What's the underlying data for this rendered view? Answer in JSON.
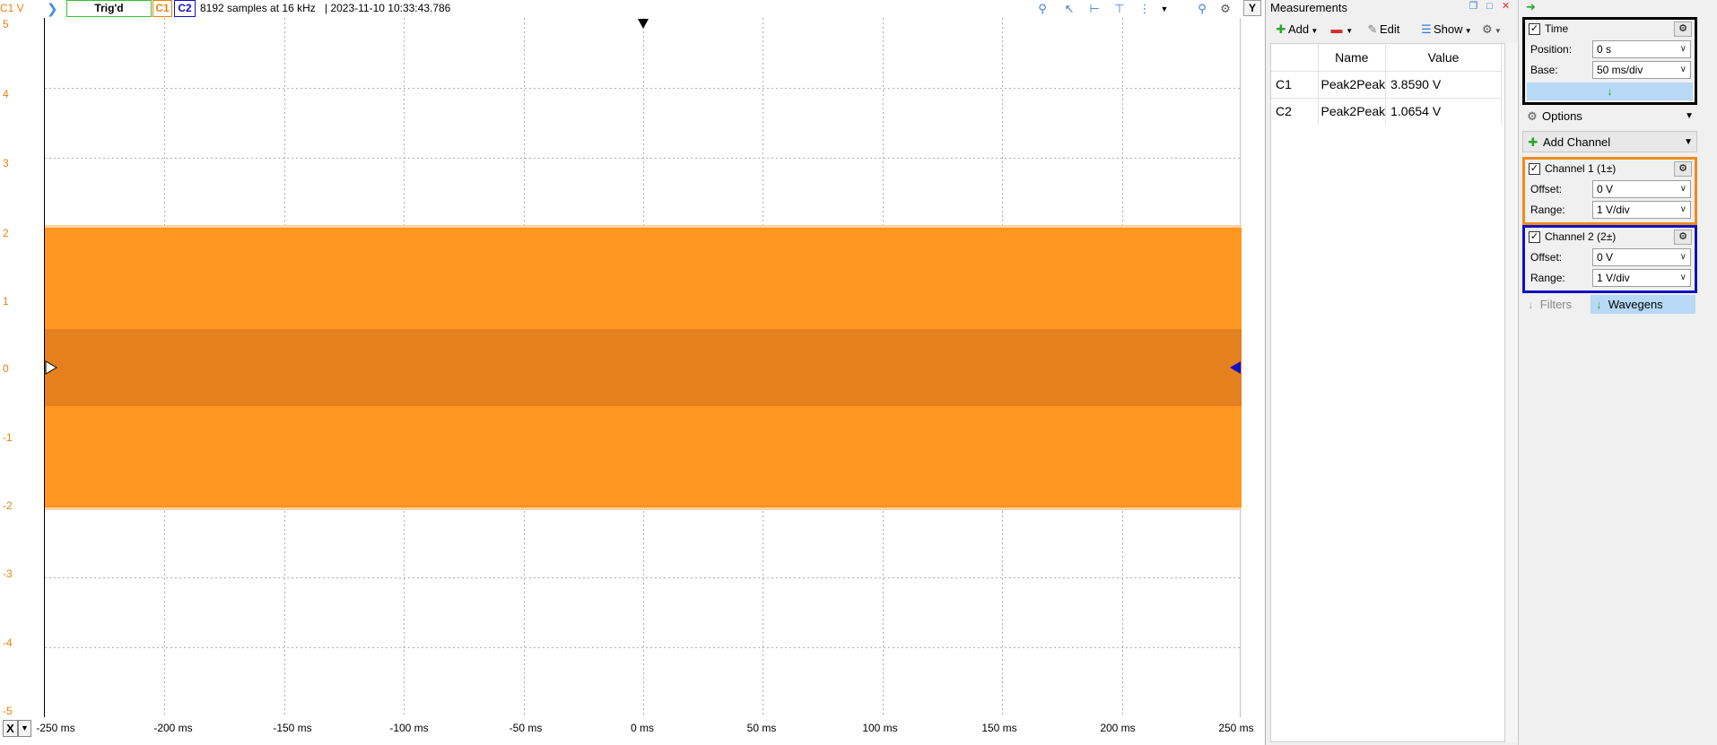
{
  "topbar": {
    "channel_unit": "C1 V",
    "trigger_status": "Trig'd",
    "c1_label": "C1",
    "c2_label": "C2",
    "samples_info": "8192 samples at 16 kHz",
    "timestamp": "|  2023-11-10 10:33:43.786",
    "y_button": "Y"
  },
  "plot": {
    "y_ticks": [
      "5",
      "4",
      "3",
      "2",
      "1",
      "0",
      "-1",
      "-2",
      "-3",
      "-4",
      "-5"
    ],
    "x_ticks": [
      "-250 ms",
      "-200 ms",
      "-150 ms",
      "-100 ms",
      "-50 ms",
      "0 ms",
      "50 ms",
      "100 ms",
      "150 ms",
      "200 ms",
      "250 ms"
    ],
    "x_button": "X",
    "colors": {
      "c1": "#fe961f",
      "c1_dark": "#e5801e",
      "c2": "#1010c8",
      "grid": "#b0b0b0"
    },
    "c1_band": {
      "max": 2.0,
      "min": -2.0
    },
    "c2_band": {
      "max": 0.55,
      "min": -0.55
    }
  },
  "measurements": {
    "title": "Measurements",
    "toolbar": {
      "add": "Add",
      "edit": "Edit",
      "show": "Show"
    },
    "columns": [
      "",
      "Name",
      "Value"
    ],
    "rows": [
      {
        "channel": "C1",
        "name": "Peak2Peak",
        "value": "3.8590 V"
      },
      {
        "channel": "C2",
        "name": "Peak2Peak",
        "value": "1.0654 V"
      }
    ]
  },
  "time": {
    "title": "Time",
    "position_label": "Position:",
    "position_value": "0 s",
    "base_label": "Base:",
    "base_value": "50 ms/div"
  },
  "options_label": "Options",
  "add_channel_label": "Add Channel",
  "channel1": {
    "title": "Channel 1 (1±)",
    "offset_label": "Offset:",
    "offset_value": "0 V",
    "range_label": "Range:",
    "range_value": "1 V/div",
    "color": "#f08a1a"
  },
  "channel2": {
    "title": "Channel 2 (2±)",
    "offset_label": "Offset:",
    "offset_value": "0 V",
    "range_label": "Range:",
    "range_value": "1 V/div",
    "color": "#1010c8"
  },
  "tabs": {
    "filters": "Filters",
    "wavegens": "Wavegens"
  }
}
